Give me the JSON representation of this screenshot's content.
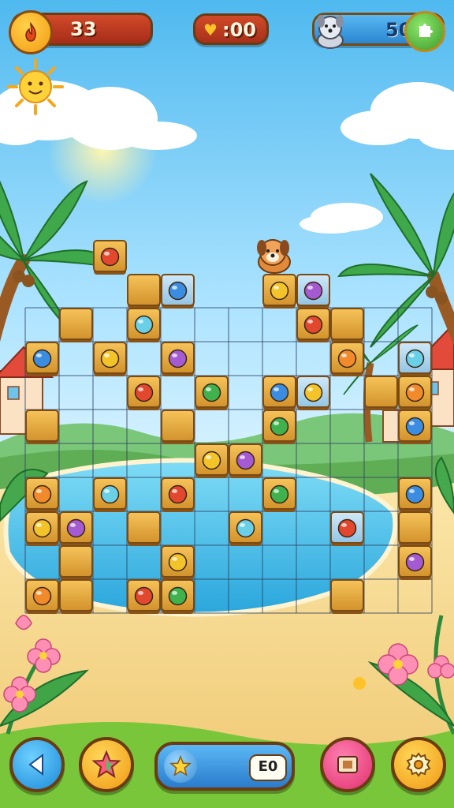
{
  "hud": {
    "coins": "33",
    "timer_heart": "♥",
    "timer": ":00",
    "score": "50",
    "score_icon": "puzzle-icon",
    "coin_icon": "flame-coin-icon",
    "avatar_icon": "puppy-icon"
  },
  "bottom_bar": {
    "back_icon": "back-arrow-icon",
    "star_icon": "star-powerup-icon",
    "progress_icon": "star-icon",
    "progress_label": "E0",
    "cards_icon": "cards-icon",
    "settings_icon": "gear-icon"
  },
  "board": {
    "columns": 12,
    "rows": 9,
    "tile_color": "#e0a83a",
    "grid_color": "#3a4a6a"
  },
  "colors": {
    "sky_top": "#55bff0",
    "sky_bottom": "#bfe9ff",
    "sand": "#f3d892",
    "water": "#48c3ea",
    "grass": "#7fc93c"
  },
  "tiles": [
    {
      "c": 2,
      "r": 0,
      "icon": "green-apple-icon",
      "type": "gold"
    },
    {
      "c": 3,
      "r": 1,
      "icon": "",
      "type": "gold"
    },
    {
      "c": 4,
      "r": 1,
      "icon": "blue-seal-icon",
      "type": "blue"
    },
    {
      "c": 7,
      "r": 1,
      "icon": "banana-icon",
      "type": "gold"
    },
    {
      "c": 8,
      "r": 1,
      "icon": "yellow-hat-icon",
      "type": "blue"
    },
    {
      "c": 1,
      "r": 2,
      "icon": "",
      "type": "gold"
    },
    {
      "c": 3,
      "r": 2,
      "icon": "gift-box-icon",
      "type": "gold"
    },
    {
      "c": 8,
      "r": 2,
      "icon": "teal-bug-icon",
      "type": "gold"
    },
    {
      "c": 9,
      "r": 2,
      "icon": "",
      "type": "gold"
    },
    {
      "c": 0,
      "r": 3,
      "icon": "yellow-bird-icon",
      "type": "gold"
    },
    {
      "c": 2,
      "r": 3,
      "icon": "gourd-icon",
      "type": "gold"
    },
    {
      "c": 4,
      "r": 3,
      "icon": "blue-tube-icon",
      "type": "gold"
    },
    {
      "c": 9,
      "r": 3,
      "icon": "red-ball-icon",
      "type": "gold"
    },
    {
      "c": 11,
      "r": 3,
      "icon": "blue-pot-icon",
      "type": "blue"
    },
    {
      "c": 3,
      "r": 4,
      "icon": "yellow-chick-icon",
      "type": "gold"
    },
    {
      "c": 5,
      "r": 4,
      "icon": "ketchup-icon",
      "type": "gold"
    },
    {
      "c": 7,
      "r": 4,
      "icon": "cupcake-icon",
      "type": "gold"
    },
    {
      "c": 8,
      "r": 4,
      "icon": "saturn-icon",
      "type": "blue"
    },
    {
      "c": 10,
      "r": 4,
      "icon": "",
      "type": "gold"
    },
    {
      "c": 11,
      "r": 4,
      "icon": "purple-flask-icon",
      "type": "gold"
    },
    {
      "c": 0,
      "r": 5,
      "icon": "",
      "type": "gold"
    },
    {
      "c": 4,
      "r": 5,
      "icon": "",
      "type": "gold"
    },
    {
      "c": 7,
      "r": 5,
      "icon": "wood-stick-icon",
      "type": "gold"
    },
    {
      "c": 11,
      "r": 5,
      "icon": "blue-bottle-icon",
      "type": "gold"
    },
    {
      "c": 5,
      "r": 6,
      "icon": "orange-cat-icon",
      "type": "gold"
    },
    {
      "c": 6,
      "r": 6,
      "icon": "carrot-icon",
      "type": "gold"
    },
    {
      "c": 0,
      "r": 7,
      "icon": "bear-icon",
      "type": "gold"
    },
    {
      "c": 2,
      "r": 7,
      "icon": "dolphin-icon",
      "type": "gold"
    },
    {
      "c": 4,
      "r": 7,
      "icon": "teapot-icon",
      "type": "gold"
    },
    {
      "c": 7,
      "r": 7,
      "icon": "blue-drop-icon",
      "type": "gold"
    },
    {
      "c": 11,
      "r": 7,
      "icon": "frog-icon",
      "type": "gold"
    },
    {
      "c": 0,
      "r": 8,
      "icon": "candy-icon",
      "type": "gold"
    },
    {
      "c": 1,
      "r": 8,
      "icon": "sneaker-icon",
      "type": "gold"
    },
    {
      "c": 3,
      "r": 8,
      "icon": "",
      "type": "gold"
    },
    {
      "c": 6,
      "r": 8,
      "icon": "green-pear-icon",
      "type": "gold"
    },
    {
      "c": 9,
      "r": 8,
      "icon": "kitten-icon",
      "type": "blue"
    },
    {
      "c": 11,
      "r": 8,
      "icon": "",
      "type": "gold"
    },
    {
      "c": 1,
      "r": 9,
      "icon": "",
      "type": "gold"
    },
    {
      "c": 4,
      "r": 9,
      "icon": "blue-pear-icon",
      "type": "gold"
    },
    {
      "c": 11,
      "r": 9,
      "icon": "turtle-icon",
      "type": "gold"
    },
    {
      "c": 0,
      "r": 10,
      "icon": "orange-cup-icon",
      "type": "gold"
    },
    {
      "c": 1,
      "r": 10,
      "icon": "",
      "type": "gold"
    },
    {
      "c": 3,
      "r": 10,
      "icon": "trumpet-icon",
      "type": "gold"
    },
    {
      "c": 4,
      "r": 10,
      "icon": "red-monkey-icon",
      "type": "gold"
    },
    {
      "c": 9,
      "r": 10,
      "icon": "",
      "type": "gold"
    }
  ]
}
